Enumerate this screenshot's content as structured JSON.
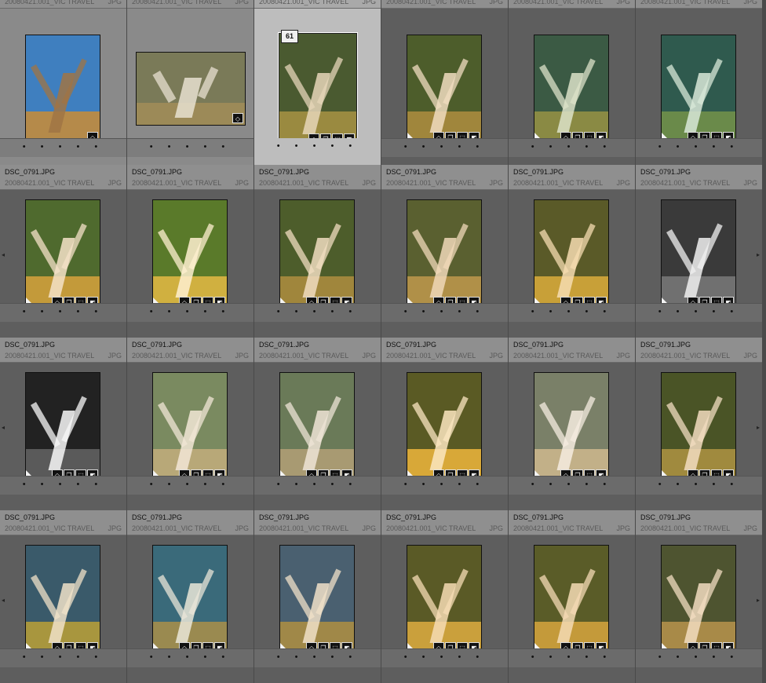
{
  "grid": {
    "file_name": "DSC_0791.JPG",
    "folder": "20080421.001_VIC TRAVEL",
    "type": "JPG",
    "selected_index_label": "61",
    "rating_dots": "• • • • •",
    "badge_icons": [
      "tag-icon",
      "copy-icon",
      "crop-icon",
      "develop-icon"
    ],
    "arrow_left": "◂",
    "arrow_right": "▸"
  },
  "thumbs": [
    {
      "variant": "sky-blue"
    },
    {
      "variant": "landscape"
    },
    {
      "variant": "warm-selected"
    },
    {
      "variant": "warm"
    },
    {
      "variant": "teal"
    },
    {
      "variant": "teal2"
    },
    {
      "variant": "green-warm"
    },
    {
      "variant": "bright"
    },
    {
      "variant": "warm"
    },
    {
      "variant": "olive"
    },
    {
      "variant": "amber"
    },
    {
      "variant": "mono"
    },
    {
      "variant": "mono-dark"
    },
    {
      "variant": "faded"
    },
    {
      "variant": "faded2"
    },
    {
      "variant": "gold"
    },
    {
      "variant": "faded3"
    },
    {
      "variant": "olive2"
    },
    {
      "variant": "cool"
    },
    {
      "variant": "cool2"
    },
    {
      "variant": "cool3"
    },
    {
      "variant": "gold2"
    },
    {
      "variant": "gold3"
    },
    {
      "variant": "warm2"
    }
  ]
}
